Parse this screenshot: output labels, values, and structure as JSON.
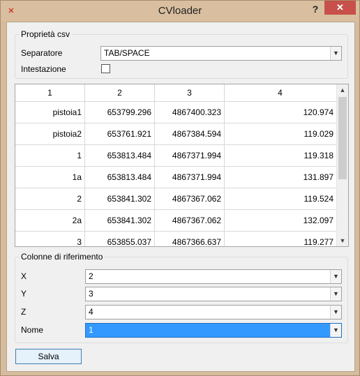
{
  "window": {
    "title": "CVloader",
    "help_label": "?",
    "close_label": "✕",
    "icon_glyph": "✕"
  },
  "csv_props": {
    "group_title": "Proprietà csv",
    "separator_label": "Separatore",
    "separator_value": "TAB/SPACE",
    "header_label": "Intestazione",
    "header_checked": false
  },
  "table": {
    "columns": [
      "1",
      "2",
      "3",
      "4"
    ],
    "rows": [
      [
        "pistoia1",
        "653799.296",
        "4867400.323",
        "120.974"
      ],
      [
        "pistoia2",
        "653761.921",
        "4867384.594",
        "119.029"
      ],
      [
        "1",
        "653813.484",
        "4867371.994",
        "119.318"
      ],
      [
        "1a",
        "653813.484",
        "4867371.994",
        "131.897"
      ],
      [
        "2",
        "653841.302",
        "4867367.062",
        "119.524"
      ],
      [
        "2a",
        "653841.302",
        "4867367.062",
        "132.097"
      ],
      [
        "3",
        "653855.037",
        "4867366.637",
        "119.277"
      ]
    ]
  },
  "ref_cols": {
    "group_title": "Colonne di riferimento",
    "x_label": "X",
    "x_value": "2",
    "y_label": "Y",
    "y_value": "3",
    "z_label": "Z",
    "z_value": "4",
    "name_label": "Nome",
    "name_value": "1"
  },
  "actions": {
    "save_label": "Salva"
  },
  "icons": {
    "dropdown": "chevron-down-icon",
    "scroll_up": "chevron-up-icon",
    "scroll_down": "chevron-down-icon"
  },
  "colors": {
    "selection": "#3399ff",
    "close_button": "#c7504a",
    "frame": "#d9bf9f"
  }
}
